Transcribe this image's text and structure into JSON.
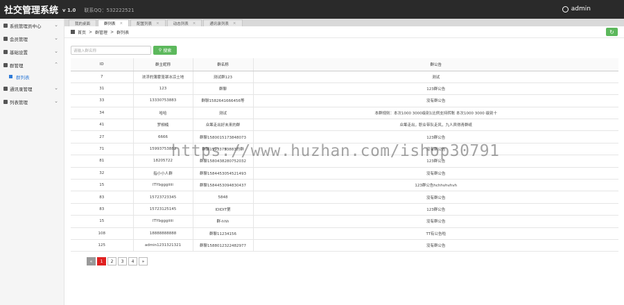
{
  "header": {
    "title": "社交管理系统",
    "version": "v 1.0",
    "contact": "联系QQ：532222521",
    "user": "admin"
  },
  "sidebar": {
    "items": [
      {
        "label": "系统管理员中心",
        "icon": "user-icon"
      },
      {
        "label": "会员管理",
        "icon": "user-icon"
      },
      {
        "label": "基础设置",
        "icon": "gear-icon"
      },
      {
        "label": "群管理",
        "icon": "users-icon",
        "open": true
      },
      {
        "label": "群列表",
        "sub": true
      },
      {
        "label": "通讯录管理",
        "icon": "list-icon"
      },
      {
        "label": "列表管理",
        "icon": "gear-icon"
      }
    ]
  },
  "tabs": [
    {
      "label": "我的桌面",
      "close": false
    },
    {
      "label": "群列表",
      "close": true,
      "active": true
    },
    {
      "label": "配置列表",
      "close": true
    },
    {
      "label": "动态列表",
      "close": true
    },
    {
      "label": "通讯录列表",
      "close": true
    }
  ],
  "breadcrumb": {
    "home": "首页",
    "sep": ">",
    "l1": "群管理",
    "l2": "群列表"
  },
  "search": {
    "placeholder": "请输入群名称",
    "button": "搜索"
  },
  "table": {
    "headers": [
      "ID",
      "群主昵称",
      "群名称",
      "群公告"
    ],
    "rows": [
      [
        "7",
        "浓浮的薄雾笼罩冰凉土地",
        "测试群123",
        "测试"
      ],
      [
        "31",
        "123",
        "群聊",
        "123群公告"
      ],
      [
        "33",
        "13330753883",
        "群聊1582641666456等",
        "没有群公告"
      ],
      [
        "34",
        "哈哈",
        "测试",
        "本群规则：本次1000 3000级别1比例支持转账 本次1000 3000 级别十"
      ],
      [
        "41",
        "罗柳楠",
        "众筹走出好未来的群",
        "众筹走出，职业带队走风，九人宾得青群纸"
      ],
      [
        "27",
        "6666",
        "群聊1580015173848073",
        "123群公告"
      ],
      [
        "71",
        "15993753883",
        "群聊15933753883的群",
        "没有群公告"
      ],
      [
        "81",
        "18205722",
        "群聊1580438280752032",
        "123群公告"
      ],
      [
        "32",
        "指小小人群",
        "群聊1584453054521493",
        "没有群公告"
      ],
      [
        "15",
        "ITYbgggiiiii",
        "群聊1584453094830437",
        "123群公告hchhvhvhvh"
      ],
      [
        "83",
        "15723723345",
        "5848",
        "没有群公告"
      ],
      [
        "83",
        "15723125145",
        "IDIDIT第",
        "123群公告"
      ],
      [
        "15",
        "ITYbgggiiiii",
        "群-hhh",
        "没有群公告"
      ],
      [
        "108",
        "18888888888",
        "群聊11234156",
        "TT有公告啦"
      ],
      [
        "125",
        "admin1231321321",
        "群聊1588012322482977",
        "没有群公告"
      ]
    ]
  },
  "pager": {
    "prev": "«",
    "pages": [
      "1",
      "2",
      "3",
      "4"
    ],
    "next": "»",
    "current": "1"
  },
  "watermark": "https://www.huzhan.com/ishop30791",
  "colors": {
    "topbar": "#2a2a2a",
    "accent": "#5cb85c",
    "current_page": "#e02020",
    "link": "#2f7bd8"
  }
}
